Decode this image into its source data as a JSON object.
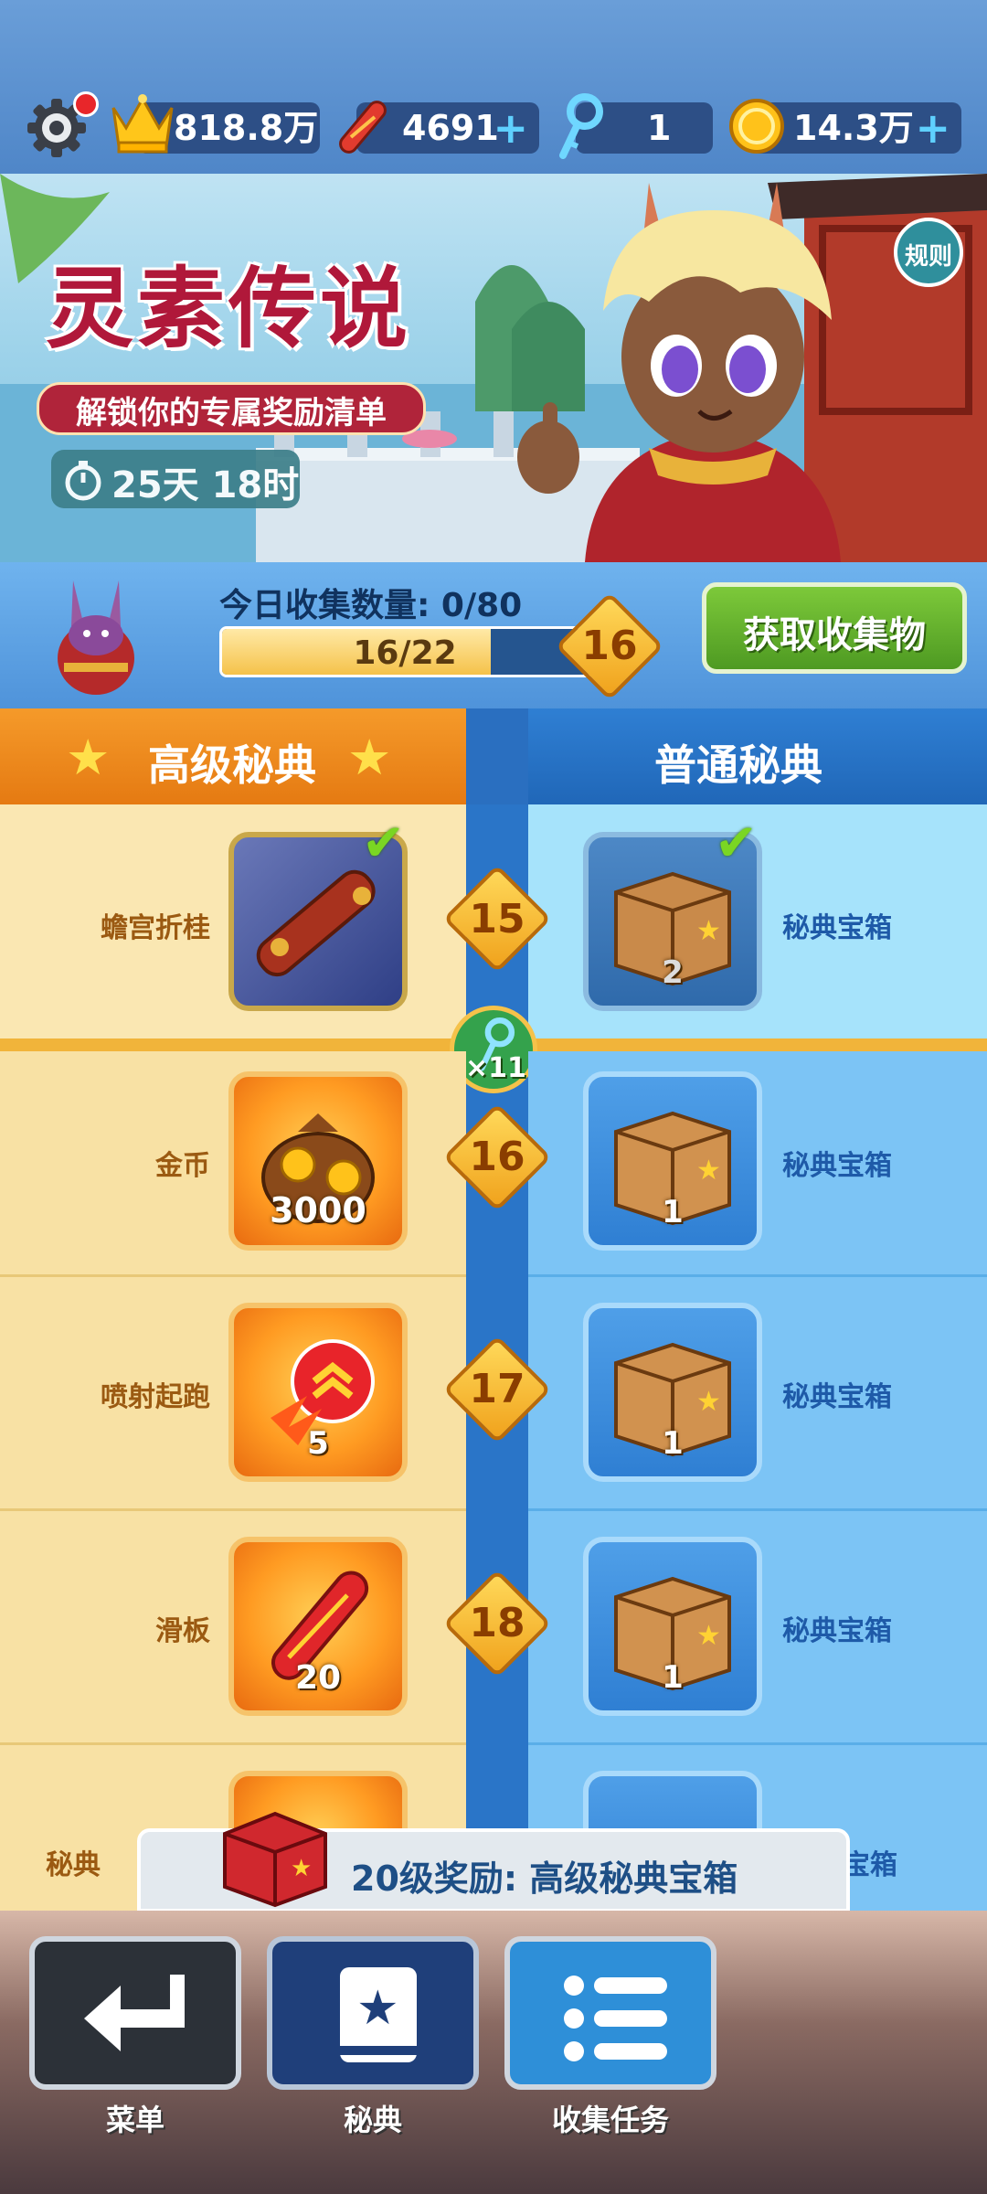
{
  "topbar": {
    "crown_value": "818.8万",
    "boards_value": "4691",
    "keys_value": "1",
    "coins_value": "14.3万"
  },
  "banner": {
    "title": "灵素传说",
    "subtitle": "解锁你的专属奖励清单",
    "timer": "25天 18时",
    "rules_button": "规则"
  },
  "progress": {
    "daily_label": "今日收集数量: 0/80",
    "bar_text": "16/22",
    "bar_fraction": 0.7273,
    "level": "16",
    "get_button": "获取收集物"
  },
  "columns": {
    "premium": "高级秘典",
    "normal": "普通秘典"
  },
  "key_badge": "×11",
  "rows": [
    {
      "level": "15",
      "premium_label": "蟾宫折桂",
      "premium_qty": "",
      "normal_label": "秘典宝箱",
      "normal_qty": "2",
      "claimed": true
    },
    {
      "level": "16",
      "premium_label": "金币",
      "premium_qty": "3000",
      "normal_label": "秘典宝箱",
      "normal_qty": "1",
      "claimed": false
    },
    {
      "level": "17",
      "premium_label": "喷射起跑",
      "premium_qty": "5",
      "normal_label": "秘典宝箱",
      "normal_qty": "1",
      "claimed": false
    },
    {
      "level": "18",
      "premium_label": "滑板",
      "premium_qty": "20",
      "normal_label": "秘典宝箱",
      "normal_qty": "1",
      "claimed": false
    }
  ],
  "partial_row": {
    "premium_label": "秘典",
    "normal_label": "宝箱"
  },
  "reward_banner": "20级奖励: 高级秘典宝箱",
  "nav": {
    "menu": "菜单",
    "book": "秘典",
    "tasks": "收集任务"
  },
  "colors": {
    "premium_header": "#f08a1c",
    "normal_header": "#2a72c8",
    "green_button": "#5fae2a",
    "diamond": "#f5b82e"
  }
}
